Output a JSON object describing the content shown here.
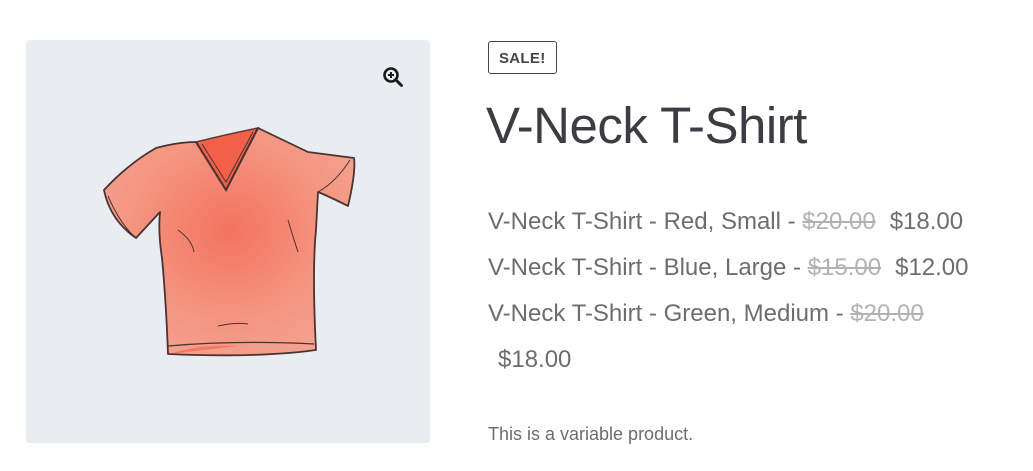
{
  "badge": {
    "sale_label": "SALE!"
  },
  "product": {
    "title": "V-Neck T-Shirt",
    "description": "This is a variable product.",
    "image_icon": "t-shirt-illustration",
    "zoom_icon": "magnifier-zoom-icon"
  },
  "variations": [
    {
      "name": "V-Neck T-Shirt - Red, Small",
      "separator": " - ",
      "regular_price": "$20.00",
      "sale_price": "$18.00"
    },
    {
      "name": "V-Neck T-Shirt - Blue, Large",
      "separator": " - ",
      "regular_price": "$15.00",
      "sale_price": "$12.00"
    },
    {
      "name": "V-Neck T-Shirt - Green, Medium",
      "separator": " - ",
      "regular_price": "$20.00",
      "sale_price": "$18.00"
    }
  ],
  "colors": {
    "gallery_bg": "#e9ecf1",
    "shirt": "#f08a78",
    "text": "#43454b",
    "muted": "#6d6d6d"
  }
}
